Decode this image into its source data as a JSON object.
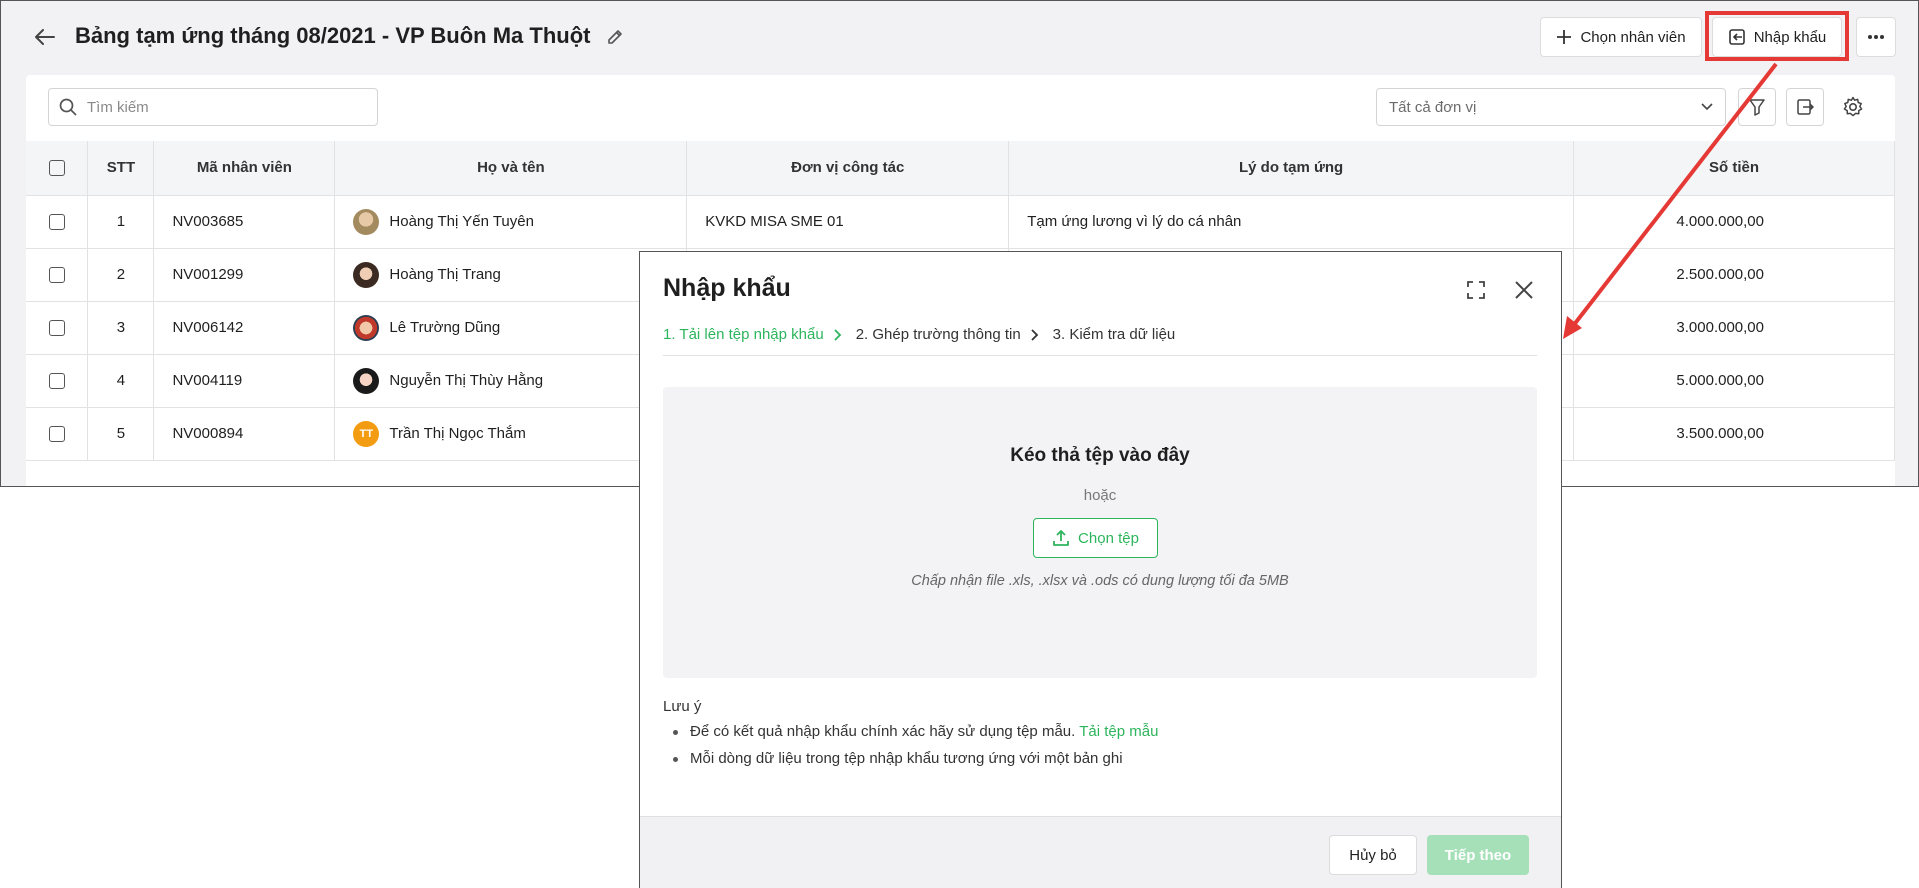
{
  "header": {
    "title": "Bảng tạm ứng tháng 08/2021 - VP Buôn Ma Thuột",
    "select_employee_label": "Chọn nhân viên",
    "import_label": "Nhập khẩu"
  },
  "toolbar": {
    "search_placeholder": "Tìm kiếm",
    "unit_filter_value": "Tất cả đơn vị"
  },
  "table": {
    "columns": [
      "STT",
      "Mã nhân viên",
      "Họ và tên",
      "Đơn vị công tác",
      "Lý do tạm ứng",
      "Số tiền"
    ],
    "rows": [
      {
        "stt": "1",
        "code": "NV003685",
        "name": "Hoàng Thị Yến Tuyên",
        "unit": "KVKD MISA SME 01",
        "reason": "Tạm ứng lương vì lý do cá nhân",
        "amount": "4.000.000,00"
      },
      {
        "stt": "2",
        "code": "NV001299",
        "name": "Hoàng Thị Trang",
        "unit": "",
        "reason": "",
        "amount": "2.500.000,00"
      },
      {
        "stt": "3",
        "code": "NV006142",
        "name": "Lê Trường Dũng",
        "unit": "",
        "reason": "",
        "amount": "3.000.000,00"
      },
      {
        "stt": "4",
        "code": "NV004119",
        "name": "Nguyễn Thị Thùy Hằng",
        "unit": "",
        "reason": "",
        "amount": "5.000.000,00"
      },
      {
        "stt": "5",
        "code": "NV000894",
        "name": "Trần Thị Ngọc Thắm",
        "unit": "",
        "reason": "",
        "amount": "3.500.000,00",
        "avatar_initials": "TT"
      }
    ]
  },
  "modal": {
    "title": "Nhập khẩu",
    "steps": [
      "1. Tải lên tệp nhập khẩu",
      "2. Ghép trường thông tin",
      "3. Kiểm tra dữ liệu"
    ],
    "dropzone": {
      "title": "Kéo thả tệp vào đây",
      "or": "hoặc",
      "button": "Chọn tệp",
      "hint": "Chấp nhận file .xls, .xlsx và .ods có dung lượng tối đa 5MB"
    },
    "note_title": "Lưu ý",
    "note_1": "Để có kết quả nhập khẩu chính xác hãy sử dụng tệp mẫu.",
    "note_1_link": "Tải tệp mẫu",
    "note_2": "Mỗi dòng dữ liệu trong tệp nhập khẩu tương ứng với một bản ghi",
    "cancel_label": "Hủy bỏ",
    "next_label": "Tiếp theo"
  },
  "colors": {
    "accent_green": "#2db55d",
    "highlight_red": "#e53935",
    "disabled_green": "#a6e0b8"
  }
}
